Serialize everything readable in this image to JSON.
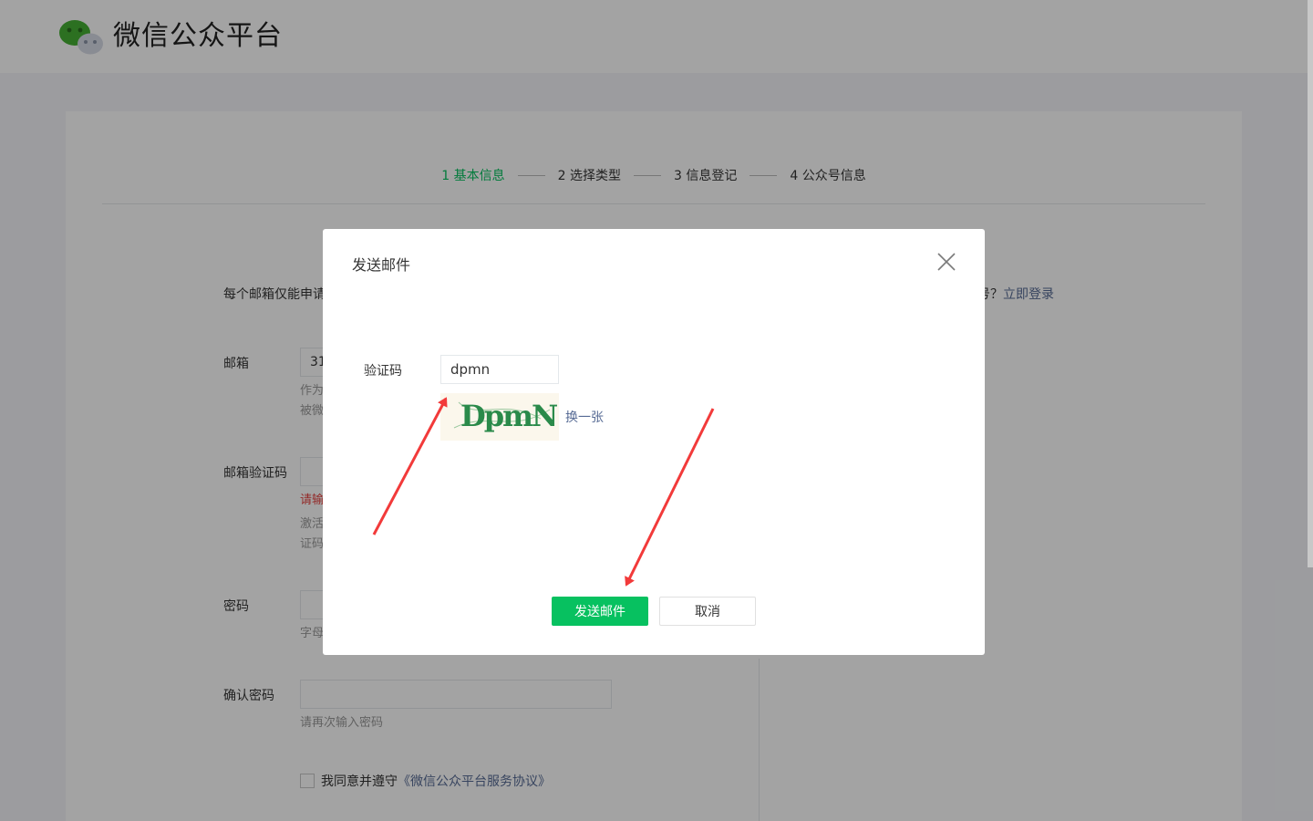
{
  "header": {
    "title": "微信公众平台"
  },
  "steps": [
    {
      "label": "1 基本信息",
      "active": true
    },
    {
      "label": "2 选择类型",
      "active": false
    },
    {
      "label": "3 信息登记",
      "active": false
    },
    {
      "label": "4 公众号信息",
      "active": false
    }
  ],
  "page": {
    "intro": "每个邮箱仅能申请",
    "login_hint_suffix": "号？",
    "login_link": "立即登录"
  },
  "form": {
    "email_label": "邮箱",
    "email_value": "31",
    "email_tip1": "作为",
    "email_tip2": "被微",
    "email_code_label": "邮箱验证码",
    "email_code_error": "请输",
    "email_code_tip1": "激活",
    "email_code_tip2": "证码",
    "password_label": "密码",
    "password_tip": "字母",
    "confirm_label": "确认密码",
    "confirm_tip": "请再次输入密码",
    "agree_prefix": "我同意并遵守",
    "agree_link": "《微信公众平台服务协议》"
  },
  "dialog": {
    "title": "发送邮件",
    "code_label": "验证码",
    "code_value": "dpmn",
    "captcha_text": "DpmN",
    "refresh_label": "换一张",
    "confirm_label": "发送邮件",
    "cancel_label": "取消"
  },
  "colors": {
    "brand": "#07c160",
    "link": "#576b95",
    "error": "#e64340",
    "annotation": "#f23a3a"
  }
}
